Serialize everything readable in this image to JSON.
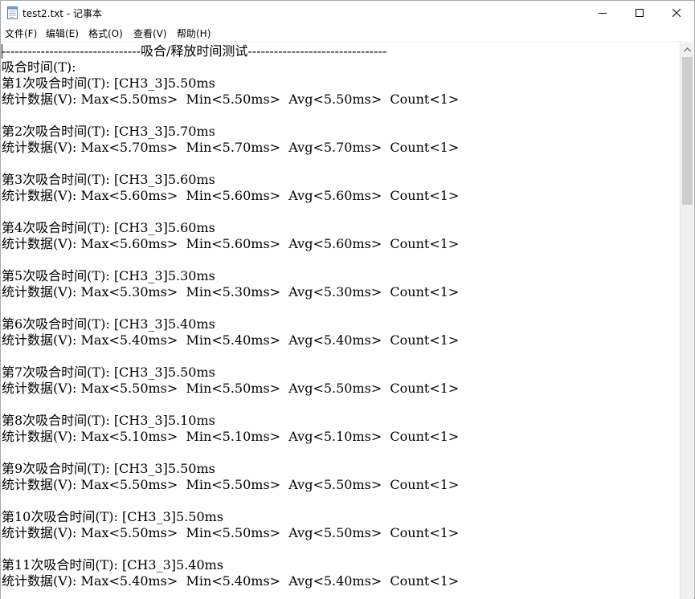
{
  "window": {
    "title": "test2.txt - 记事本"
  },
  "menu": {
    "file": "文件(F)",
    "edit": "编辑(E)",
    "format": "格式(O)",
    "view": "查看(V)",
    "help": "帮助(H)"
  },
  "document": {
    "lines": [
      "--------------------------------吸合/释放时间测试--------------------------------",
      "吸合时间(T):",
      "第1次吸合时间(T): [CH3_3]5.50ms",
      "统计数据(V): Max<5.50ms>  Min<5.50ms>  Avg<5.50ms>  Count<1>",
      "",
      "第2次吸合时间(T): [CH3_3]5.70ms",
      "统计数据(V): Max<5.70ms>  Min<5.70ms>  Avg<5.70ms>  Count<1>",
      "",
      "第3次吸合时间(T): [CH3_3]5.60ms",
      "统计数据(V): Max<5.60ms>  Min<5.60ms>  Avg<5.60ms>  Count<1>",
      "",
      "第4次吸合时间(T): [CH3_3]5.60ms",
      "统计数据(V): Max<5.60ms>  Min<5.60ms>  Avg<5.60ms>  Count<1>",
      "",
      "第5次吸合时间(T): [CH3_3]5.30ms",
      "统计数据(V): Max<5.30ms>  Min<5.30ms>  Avg<5.30ms>  Count<1>",
      "",
      "第6次吸合时间(T): [CH3_3]5.40ms",
      "统计数据(V): Max<5.40ms>  Min<5.40ms>  Avg<5.40ms>  Count<1>",
      "",
      "第7次吸合时间(T): [CH3_3]5.50ms",
      "统计数据(V): Max<5.50ms>  Min<5.50ms>  Avg<5.50ms>  Count<1>",
      "",
      "第8次吸合时间(T): [CH3_3]5.10ms",
      "统计数据(V): Max<5.10ms>  Min<5.10ms>  Avg<5.10ms>  Count<1>",
      "",
      "第9次吸合时间(T): [CH3_3]5.50ms",
      "统计数据(V): Max<5.50ms>  Min<5.50ms>  Avg<5.50ms>  Count<1>",
      "",
      "第10次吸合时间(T): [CH3_3]5.50ms",
      "统计数据(V): Max<5.50ms>  Min<5.50ms>  Avg<5.50ms>  Count<1>",
      "",
      "第11次吸合时间(T): [CH3_3]5.40ms",
      "统计数据(V): Max<5.40ms>  Min<5.40ms>  Avg<5.40ms>  Count<1>"
    ]
  },
  "icons": {
    "app": "notepad-icon",
    "minimize": "minimize-icon",
    "maximize": "maximize-icon",
    "close": "close-icon",
    "scroll_up": "scroll-up-arrow-icon"
  }
}
